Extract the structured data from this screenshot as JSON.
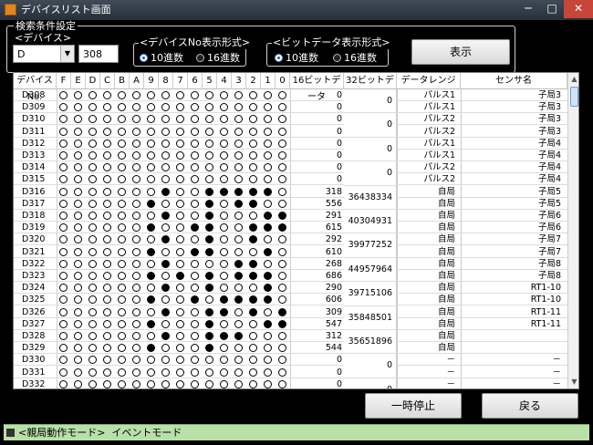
{
  "window": {
    "title": "デバイスリスト画面",
    "min_glyph": "─",
    "max_glyph": "□",
    "close_glyph": "✕"
  },
  "filter": {
    "title": "検索条件設定",
    "device_title": "<デバイス>",
    "device_type": "D",
    "device_number": "308",
    "devno_group": {
      "title": "<デバイスNo表示形式>",
      "opt1": "10進数",
      "opt2": "16進数",
      "selected": "10進数"
    },
    "bitdata_group": {
      "title": "<ビットデータ表示形式>",
      "opt1": "10進数",
      "opt2": "16進数",
      "selected": "10進数"
    },
    "display_label": "表示"
  },
  "grid": {
    "headers": [
      "デバイスNo.",
      "F",
      "E",
      "D",
      "C",
      "B",
      "A",
      "9",
      "8",
      "7",
      "6",
      "5",
      "4",
      "3",
      "2",
      "1",
      "0",
      "16ビットデータ",
      "32ビットデータ",
      "データレンジ",
      "センサ名"
    ],
    "rows": [
      {
        "dev": "D308",
        "bits": "0000000000000000",
        "v16": "0",
        "range": "パルス1",
        "sensor": "子局3"
      },
      {
        "dev": "D309",
        "bits": "0000000000000000",
        "v16": "0",
        "range": "パルス1",
        "sensor": "子局3"
      },
      {
        "dev": "D310",
        "bits": "0000000000000000",
        "v16": "0",
        "range": "パルス2",
        "sensor": "子局3"
      },
      {
        "dev": "D311",
        "bits": "0000000000000000",
        "v16": "0",
        "range": "パルス2",
        "sensor": "子局3"
      },
      {
        "dev": "D312",
        "bits": "0000000000000000",
        "v16": "0",
        "range": "パルス1",
        "sensor": "子局4"
      },
      {
        "dev": "D313",
        "bits": "0000000000000000",
        "v16": "0",
        "range": "パルス1",
        "sensor": "子局4"
      },
      {
        "dev": "D314",
        "bits": "0000000000000000",
        "v16": "0",
        "range": "パルス2",
        "sensor": "子局4"
      },
      {
        "dev": "D315",
        "bits": "0000000000000000",
        "v16": "0",
        "range": "パルス2",
        "sensor": "子局4"
      },
      {
        "dev": "D316",
        "bits": "0000000100111110",
        "v16": "318",
        "range": "自局",
        "sensor": "子局5"
      },
      {
        "dev": "D317",
        "bits": "0000001000101100",
        "v16": "556",
        "range": "自局",
        "sensor": "子局5"
      },
      {
        "dev": "D318",
        "bits": "0000000100100011",
        "v16": "291",
        "range": "自局",
        "sensor": "子局6"
      },
      {
        "dev": "D319",
        "bits": "0000001001100111",
        "v16": "615",
        "range": "自局",
        "sensor": "子局6"
      },
      {
        "dev": "D320",
        "bits": "0000000100100100",
        "v16": "292",
        "range": "自局",
        "sensor": "子局7"
      },
      {
        "dev": "D321",
        "bits": "0000001001100010",
        "v16": "610",
        "range": "自局",
        "sensor": "子局7"
      },
      {
        "dev": "D322",
        "bits": "0000000100001100",
        "v16": "268",
        "range": "自局",
        "sensor": "子局8"
      },
      {
        "dev": "D323",
        "bits": "0000001010101110",
        "v16": "686",
        "range": "自局",
        "sensor": "子局8"
      },
      {
        "dev": "D324",
        "bits": "0000000100100010",
        "v16": "290",
        "range": "自局",
        "sensor": "RT1-10"
      },
      {
        "dev": "D325",
        "bits": "0000001001011110",
        "v16": "606",
        "range": "自局",
        "sensor": "RT1-10"
      },
      {
        "dev": "D326",
        "bits": "0000000100110101",
        "v16": "309",
        "range": "自局",
        "sensor": "RT1-11"
      },
      {
        "dev": "D327",
        "bits": "0000001000100011",
        "v16": "547",
        "range": "自局",
        "sensor": "RT1-11"
      },
      {
        "dev": "D328",
        "bits": "0000000100111000",
        "v16": "312",
        "range": "自局",
        "sensor": ""
      },
      {
        "dev": "D329",
        "bits": "0000001000100000",
        "v16": "544",
        "range": "自局",
        "sensor": ""
      },
      {
        "dev": "D330",
        "bits": "0000000000000000",
        "v16": "0",
        "range": "－",
        "sensor": "－"
      },
      {
        "dev": "D331",
        "bits": "0000000000000000",
        "v16": "0",
        "range": "－",
        "sensor": "－"
      },
      {
        "dev": "D332",
        "bits": "0000000000000000",
        "v16": "0",
        "range": "－",
        "sensor": "－"
      }
    ],
    "v32": [
      "0",
      "0",
      "0",
      "0",
      "36438334",
      "40304931",
      "39977252",
      "44957964",
      "39715106",
      "35848501",
      "35651896",
      "0",
      "0"
    ]
  },
  "buttons": {
    "pause": "一時停止",
    "back": "戻る"
  },
  "status": {
    "text": "<親局動作モード>  イベントモード"
  },
  "colors": {
    "status_bar": "#b9e0a8",
    "close_button": "#c7463a"
  }
}
